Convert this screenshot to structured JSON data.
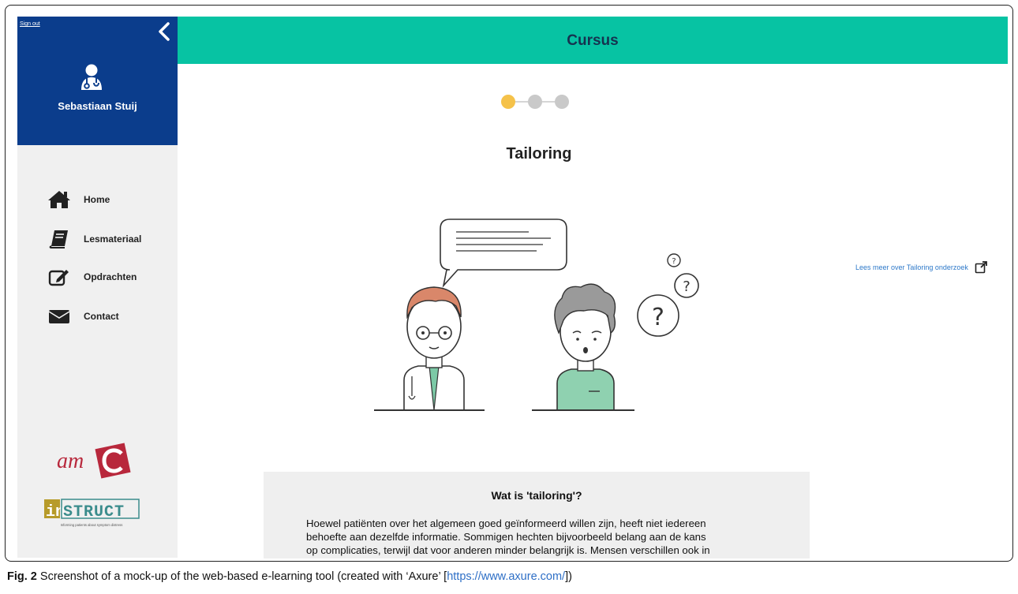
{
  "sidebar": {
    "signout_label": "Sign out",
    "user_name": "Sebastiaan Stuij",
    "items": [
      {
        "label": "Home",
        "icon": "home-icon"
      },
      {
        "label": "Lesmateriaal",
        "icon": "book-icon"
      },
      {
        "label": "Opdrachten",
        "icon": "edit-icon"
      },
      {
        "label": "Contact",
        "icon": "envelope-icon"
      }
    ],
    "logos": {
      "amc": "amc",
      "instruct": "instruct",
      "instruct_tagline": "Informing patients about symptom distress"
    }
  },
  "header": {
    "title": "Cursus"
  },
  "progress": {
    "current_step": 1,
    "total_steps": 3
  },
  "main": {
    "heading": "Tailoring",
    "external_link": "Lees meer over Tailoring onderzoek",
    "info_title": "Wat is 'tailoring'?",
    "info_lines": [
      "Hoewel patiënten over het algemeen goed geïnformeerd willen zijn, heeft niet iedereen",
      "behoefte aan dezelfde informatie. Sommigen hechten bijvoorbeeld belang aan de kans",
      "op complicaties, terwijl dat voor anderen minder belangrijk is. Mensen verschillen ook in"
    ]
  },
  "caption": {
    "fig_label": "Fig. 2",
    "text": " Screenshot of a mock-up of the web-based e-learning tool (created with ‘Axure’ [",
    "url": "https://www.axure.com/",
    "end": "])"
  },
  "colors": {
    "header": "#07c3a3",
    "profile": "#0b3d8c",
    "dot_active": "#f5c24a",
    "dot_inactive": "#c9c9c9",
    "link": "#2e79c9"
  }
}
